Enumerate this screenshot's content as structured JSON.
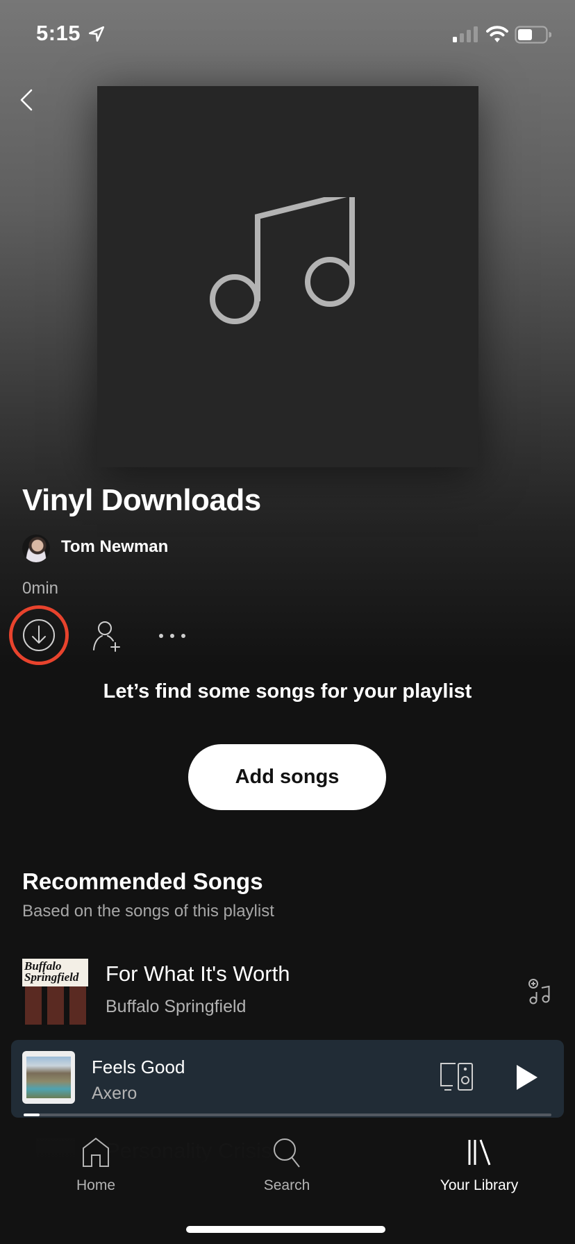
{
  "status_bar": {
    "time": "5:15",
    "location_icon": "location-arrow-icon",
    "signal_icon": "cellular-signal-icon",
    "wifi_icon": "wifi-icon",
    "battery_icon": "battery-icon"
  },
  "header": {
    "back_icon": "chevron-left-icon"
  },
  "playlist": {
    "cover_icon": "music-note-icon",
    "title": "Vinyl Downloads",
    "owner": "Tom Newman",
    "duration": "0min",
    "actions": {
      "download_icon": "download-circle-icon",
      "add_user_icon": "add-user-icon",
      "more_icon": "more-dots-icon"
    }
  },
  "empty_state": {
    "prompt": "Let’s find some songs for your playlist",
    "add_songs_label": "Add songs"
  },
  "recommended": {
    "title": "Recommended Songs",
    "subtitle": "Based on the songs of this playlist",
    "songs": [
      {
        "title": "For What It's Worth",
        "artist": "Buffalo Springfield",
        "art_text": "Buffalo Springfield"
      },
      {
        "title": "Personality Crisis"
      }
    ]
  },
  "now_playing": {
    "title": "Feels Good",
    "artist": "Axero",
    "progress_fraction": 0.03,
    "devices_icon": "devices-icon",
    "play_icon": "play-icon"
  },
  "nav": {
    "items": [
      {
        "label": "Home",
        "icon": "home-icon",
        "active": false
      },
      {
        "label": "Search",
        "icon": "search-icon",
        "active": false
      },
      {
        "label": "Your Library",
        "icon": "library-icon",
        "active": true
      }
    ]
  },
  "colors": {
    "highlight_ring": "#e8432d",
    "mini_player_bg": "#212c36",
    "background": "#121212"
  }
}
